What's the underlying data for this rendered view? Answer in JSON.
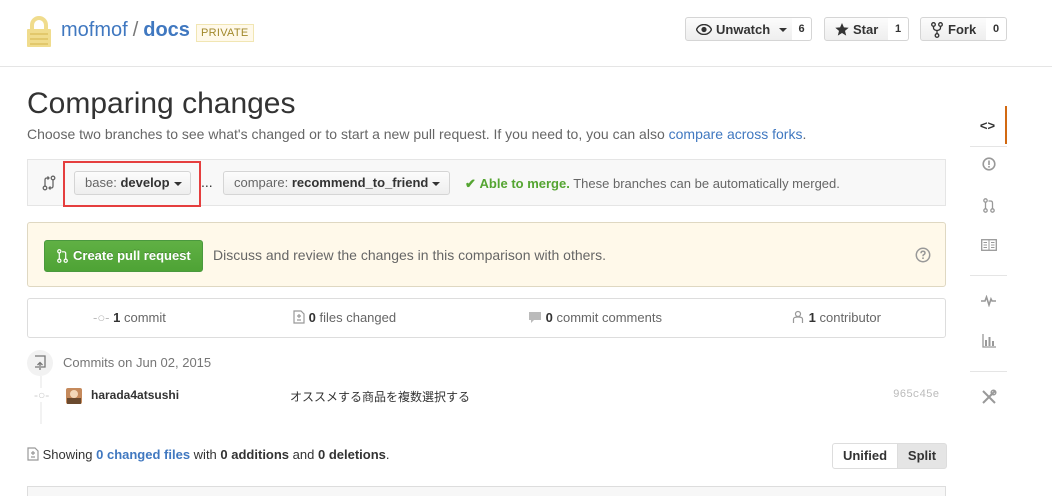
{
  "repo": {
    "owner": "mofmof",
    "separator": "/",
    "name": "docs",
    "visibility": "PRIVATE"
  },
  "actions": {
    "watch": {
      "label": "Unwatch",
      "count": "6"
    },
    "star": {
      "label": "Star",
      "count": "1"
    },
    "fork": {
      "label": "Fork",
      "count": "0"
    }
  },
  "page": {
    "title": "Comparing changes",
    "lead_text": "Choose two branches to see what's changed or to start a new pull request. If you need to, you can also ",
    "lead_link": "compare across forks",
    "lead_end": "."
  },
  "range": {
    "base_prefix": "base:",
    "base_branch": "develop",
    "dots": "...",
    "compare_prefix": "compare:",
    "compare_branch": "recommend_to_friend",
    "merge_status": "Able to merge.",
    "merge_detail": "These branches can be automatically merged."
  },
  "banner": {
    "create_button": "Create pull request",
    "text": "Discuss and review the changes in this comparison with others."
  },
  "summary": {
    "commits": {
      "count": "1",
      "label": "commit"
    },
    "files": {
      "count": "0",
      "label": "files changed"
    },
    "comments": {
      "count": "0",
      "label": "commit comments"
    },
    "contributors": {
      "count": "1",
      "label": "contributor"
    }
  },
  "commits": {
    "date_heading": "Commits on Jun 02, 2015",
    "items": [
      {
        "author": "harada4atsushi",
        "message": "オススメする商品を複数選択する",
        "sha": "965c45e"
      }
    ]
  },
  "toc": {
    "showing": "Showing",
    "changed_files": "0 changed files",
    "with": "with",
    "additions": "0 additions",
    "and": "and",
    "deletions": "0 deletions",
    "end": "."
  },
  "diff_view": {
    "unified": "Unified",
    "split": "Split"
  },
  "colors": {
    "accent_link": "#4078c0",
    "success": "#55a532",
    "create_button": "#55a532",
    "highlight_box": "#e53e3e",
    "sidebar_selected": "#d26911"
  },
  "sidebar_icons": [
    "code-icon",
    "issue-icon",
    "pull-request-icon",
    "wiki-icon",
    "pulse-icon",
    "graph-icon",
    "settings-icon"
  ]
}
